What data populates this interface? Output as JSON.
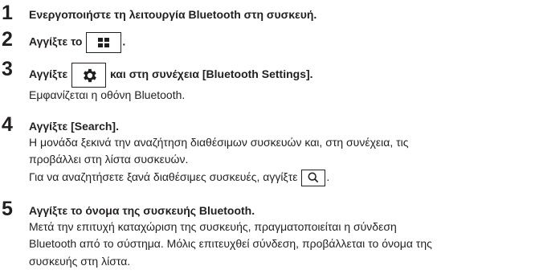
{
  "steps": [
    {
      "number": "1",
      "text": "Ενεργοποιήστε τη λειτουργία Bluetooth στη συσκευή."
    },
    {
      "number": "2",
      "text_before": "Αγγίξτε το",
      "text_after": ".",
      "icon": "home-grid-icon"
    },
    {
      "number": "3",
      "text_before": "Αγγίξτε",
      "text_after": "και στη συνέχεια [Bluetooth Settings].",
      "icon": "gear-icon",
      "body": [
        "Εμφανίζεται η οθόνη Bluetooth."
      ]
    },
    {
      "number": "4",
      "text": "Αγγίξτε [Search].",
      "body": [
        "Η μονάδα ξεκινά την αναζήτηση διαθέσιμων συσκευών και, στη συνέχεια, τις",
        "προβάλλει στη λίστα συσκευών."
      ],
      "search_line_before": "Για να αναζητήσετε ξανά διαθέσιμες συσκευές, αγγίξτε",
      "search_line_after": ".",
      "search_icon": "search-icon"
    },
    {
      "number": "5",
      "text": "Αγγίξτε το όνομα της συσκευής Bluetooth.",
      "body": [
        "Μετά την επιτυχή καταχώριση της συσκευής, πραγματοποιείται η σύνδεση",
        "Bluetooth από το σύστημα. Μόλις επιτευχθεί σύνδεση, προβάλλεται το όνομα της",
        "συσκευής στη λίστα."
      ]
    }
  ]
}
